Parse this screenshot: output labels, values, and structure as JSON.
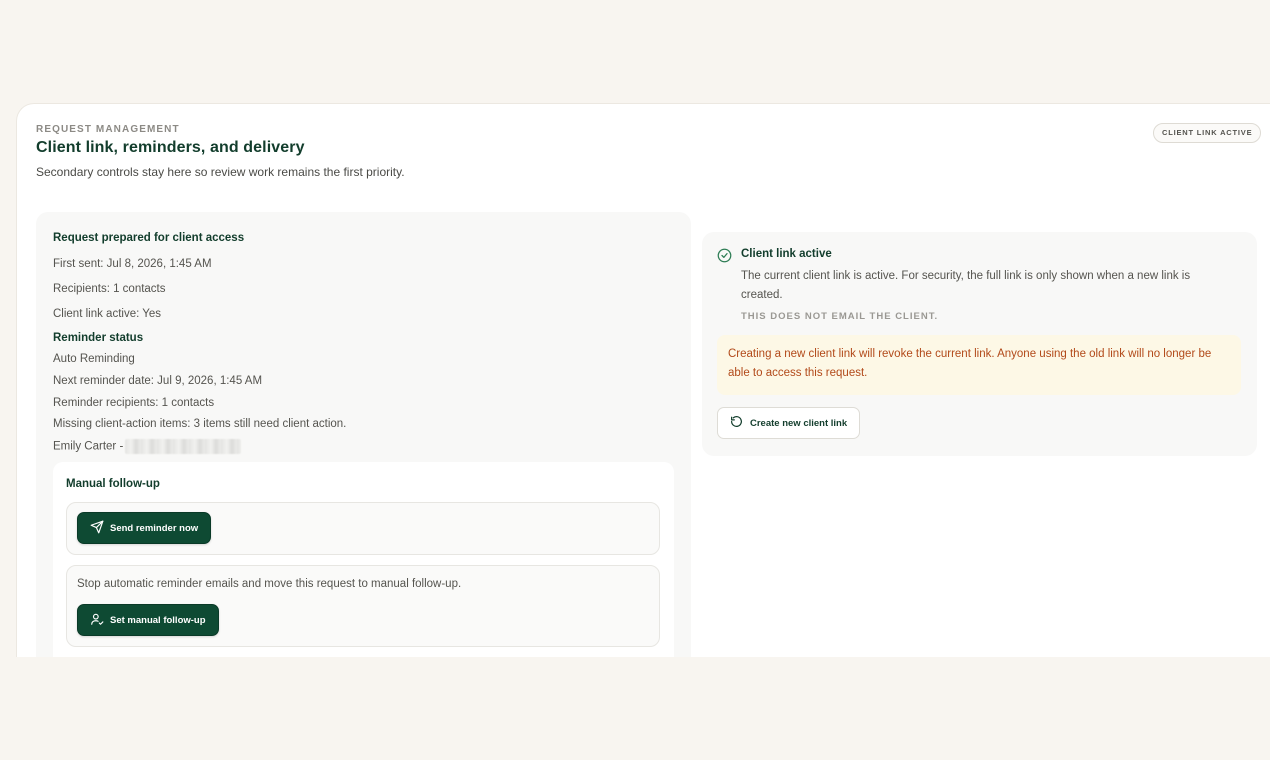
{
  "section": {
    "eyebrow": "REQUEST MANAGEMENT",
    "title": "Client link, reminders, and delivery",
    "subtitle": "Secondary controls stay here so review work remains the first priority.",
    "status_badge": "CLIENT LINK ACTIVE"
  },
  "request": {
    "title": "Request prepared for client access",
    "first_sent": "First sent: Jul 8, 2026, 1:45 AM",
    "recipients": "Recipients: 1 contacts",
    "client_link_active": "Client link active: Yes"
  },
  "reminder": {
    "heading": "Reminder status",
    "mode": "Auto Reminding",
    "next_date": "Next reminder date: Jul 9, 2026, 1:45 AM",
    "recipients": "Reminder recipients: 1 contacts",
    "missing_items": "Missing client-action items: 3 items still need client action.",
    "contact": "Emily Carter -"
  },
  "followup": {
    "title": "Manual follow-up",
    "send_button": "Send reminder now",
    "manual_text": "Stop automatic reminder emails and move this request to manual follow-up.",
    "manual_button": "Set manual follow-up"
  },
  "client_link": {
    "title": "Client link active",
    "description": "The current client link is active. For security, the full link is only shown when a new link is created.",
    "note": "THIS DOES NOT EMAIL THE CLIENT.",
    "warning": "Creating a new client link will revoke the current link. Anyone using the old link will no longer be able to access this request.",
    "create_button": "Create new client link"
  },
  "icons": {
    "send": "send-icon",
    "user": "user-icon",
    "check": "check-circle-icon",
    "refresh": "refresh-icon"
  },
  "colors": {
    "background": "#f8f5f0",
    "brand_green": "#0e4a33",
    "heading_green": "#123d2c",
    "warning_text": "#b24a1a",
    "warning_bg": "#fdf8e6"
  }
}
